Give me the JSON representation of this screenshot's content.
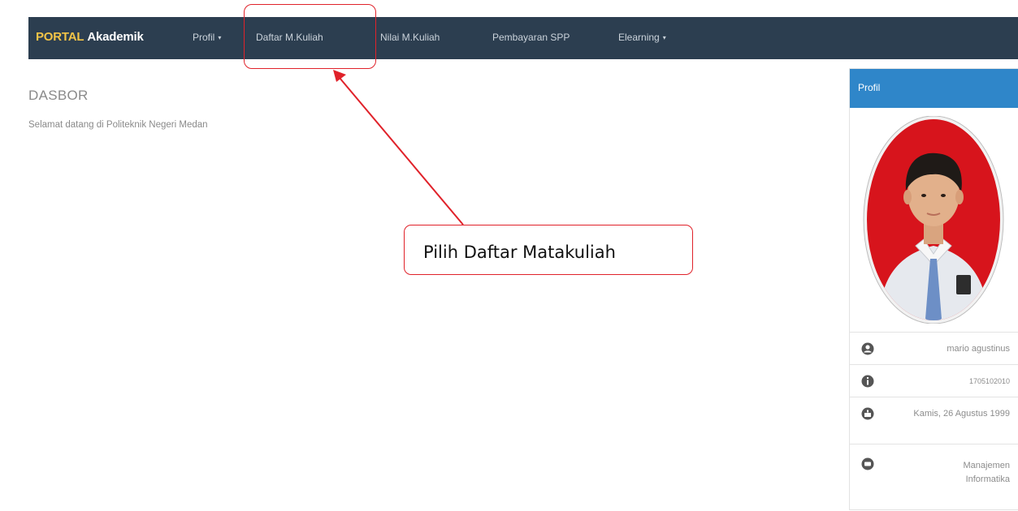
{
  "navbar": {
    "brand_part1": "PORTAL",
    "brand_part2": "Akademik",
    "items": [
      {
        "label": "Profil",
        "dropdown": true
      },
      {
        "label": "Daftar M.Kuliah",
        "dropdown": false
      },
      {
        "label": "Nilai M.Kuliah",
        "dropdown": false
      },
      {
        "label": "Pembayaran SPP",
        "dropdown": false
      },
      {
        "label": "Elearning",
        "dropdown": true
      }
    ],
    "caret": "▾"
  },
  "main": {
    "title": "DASBOR",
    "welcome": "Selamat datang di Politeknik Negeri Medan"
  },
  "profile": {
    "header": "Profil",
    "name": "mario agustinus",
    "nim": "1705102010",
    "birth_date": "Kamis, 26 Agustus 1999",
    "program": "Manajemen Informatika"
  },
  "annotation": {
    "callout_text": "Pilih Daftar Matakuliah"
  },
  "colors": {
    "navbar_bg": "#2c3e50",
    "brand_accent": "#f3c447",
    "panel_header": "#2f86c9",
    "annotation_red": "#e0222a"
  }
}
